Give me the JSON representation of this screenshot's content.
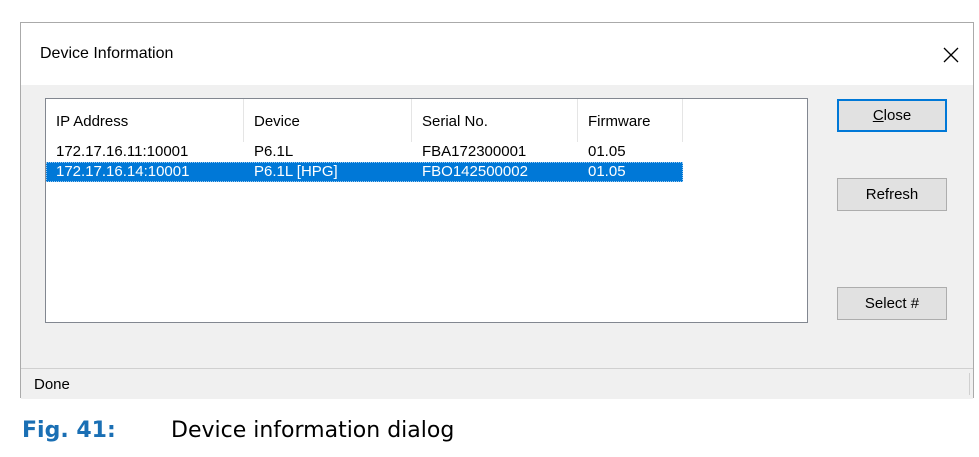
{
  "dialog": {
    "title": "Device Information",
    "close_icon": "close-icon"
  },
  "list": {
    "columns": [
      "IP Address",
      "Device",
      "Serial No.",
      "Firmware"
    ],
    "rows": [
      {
        "ip": "172.17.16.11:10001",
        "device": "P6.1L",
        "serial": "FBA172300001",
        "firmware": "01.05",
        "selected": false
      },
      {
        "ip": "172.17.16.14:10001",
        "device": "P6.1L [HPG]",
        "serial": "FBO142500002",
        "firmware": "01.05",
        "selected": true
      }
    ]
  },
  "buttons": {
    "close_accel": "C",
    "close_rest": "lose",
    "refresh": "Refresh",
    "select": "Select #"
  },
  "status": {
    "text": "Done"
  },
  "caption": {
    "number": "Fig. 41:",
    "text": "Device information dialog"
  },
  "colors": {
    "selection": "#0078d7",
    "caption_accent": "#1a6fb4"
  }
}
